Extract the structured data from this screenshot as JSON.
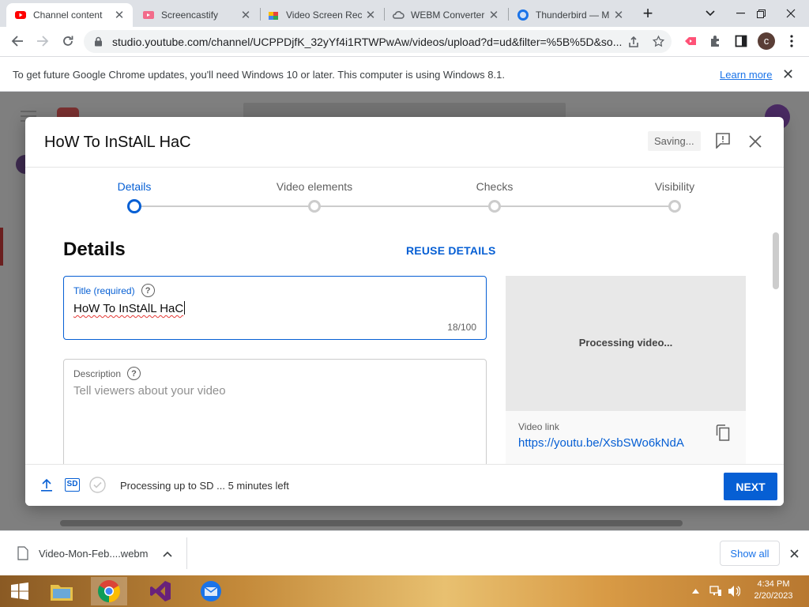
{
  "browser": {
    "tabs": [
      {
        "title": "Channel content",
        "icon": "youtube-icon",
        "active": true
      },
      {
        "title": "Screencastify",
        "icon": "screencastify-icon"
      },
      {
        "title": "Video Screen Rec",
        "icon": "chrome-store-icon"
      },
      {
        "title": "WEBM Converter",
        "icon": "cloud-icon"
      },
      {
        "title": "Thunderbird — M",
        "icon": "thunderbird-icon"
      }
    ],
    "new_tab_label": "+",
    "url": "studio.youtube.com/channel/UCPPDjfK_32yYf4i1RTWPwAw/videos/upload?d=ud&filter=%5B%5D&so...",
    "profile_letter": "c"
  },
  "infobar": {
    "message": "To get future Google Chrome updates, you'll need Windows 10 or later. This computer is using Windows 8.1.",
    "link": "Learn more"
  },
  "dialog": {
    "title": "HoW To InStAlL HaC",
    "saving_label": "Saving...",
    "steps": [
      {
        "label": "Details",
        "active": true
      },
      {
        "label": "Video elements"
      },
      {
        "label": "Checks"
      },
      {
        "label": "Visibility"
      }
    ],
    "section_heading": "Details",
    "reuse_label": "REUSE DETAILS",
    "title_field": {
      "label": "Title (required)",
      "value": "HoW To InStAlL HaC",
      "count": "18/100"
    },
    "description_field": {
      "label": "Description",
      "placeholder": "Tell viewers about your video"
    },
    "preview": {
      "status": "Processing video...",
      "link_label": "Video link",
      "link_url": "https://youtu.be/XsbSWo6kNdA"
    },
    "footer": {
      "status": "Processing up to SD ... 5 minutes left",
      "sd_badge": "SD",
      "next_label": "NEXT"
    }
  },
  "downloads": {
    "file": "Video-Mon-Feb....webm",
    "show_all": "Show all"
  },
  "taskbar": {
    "time": "4:34 PM",
    "date": "2/20/2023"
  },
  "colors": {
    "accent": "#065fd4",
    "youtube_red": "#ff0000"
  }
}
